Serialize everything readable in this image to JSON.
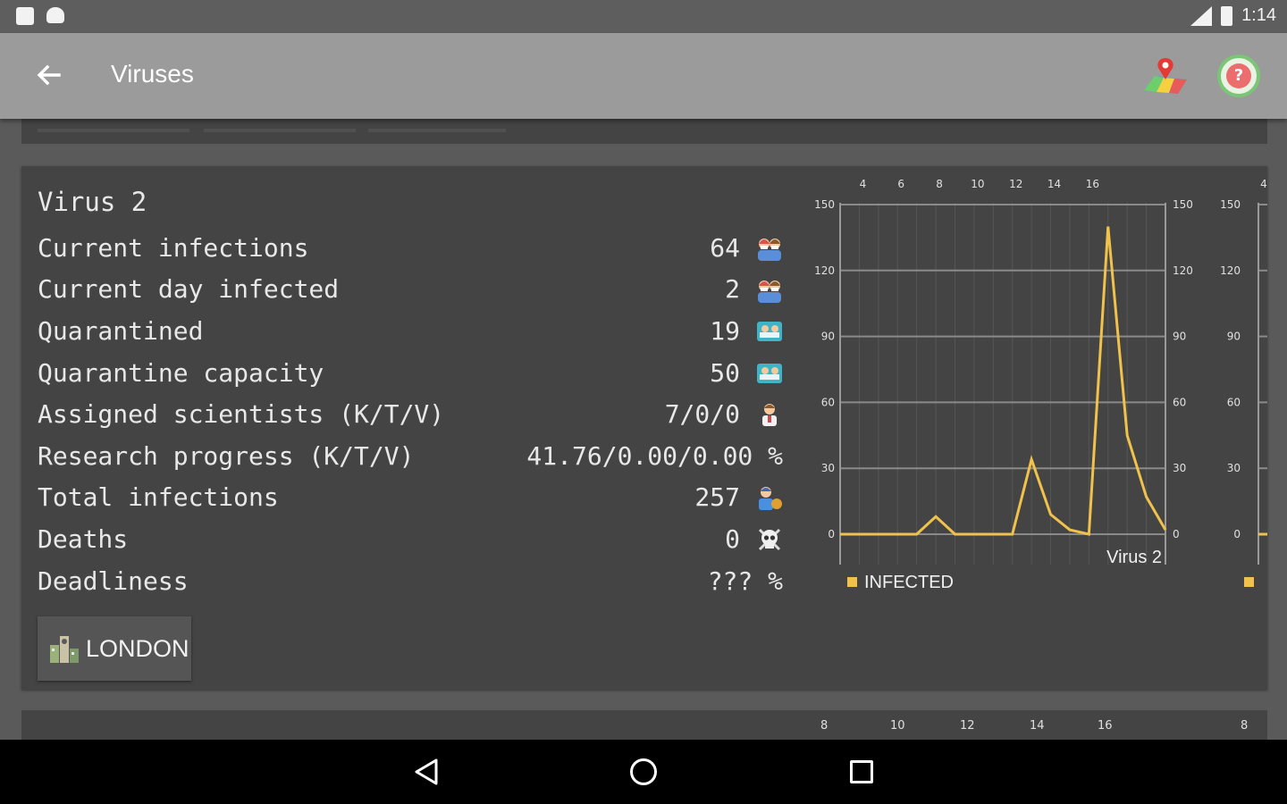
{
  "status_bar": {
    "time": "1:14"
  },
  "app_bar": {
    "title": "Viruses"
  },
  "virus": {
    "name": "Virus 2",
    "rows": [
      {
        "label": "Current infections",
        "value": "64",
        "icon": "infected-people-icon"
      },
      {
        "label": "Current day infected",
        "value": "2",
        "icon": "infected-people-icon"
      },
      {
        "label": "Quarantined",
        "value": "19",
        "icon": "quarantine-icon"
      },
      {
        "label": "Quarantine capacity",
        "value": "50",
        "icon": "quarantine-icon"
      },
      {
        "label": "Assigned scientists (K/T/V)",
        "value": "7/0/0",
        "icon": "scientist-icon"
      },
      {
        "label": "Research progress (K/T/V)",
        "value": "41.76/0.00/0.00 %",
        "icon": ""
      },
      {
        "label": "Total infections",
        "value": "257",
        "icon": "total-infections-icon"
      },
      {
        "label": "Deaths",
        "value": "0",
        "icon": "skull-icon"
      },
      {
        "label": "Deadliness",
        "value": "??? %",
        "icon": ""
      }
    ],
    "city_button": "LONDON"
  },
  "colors": {
    "line": "#f0c24b",
    "card": "#444444",
    "appbar": "#9b9b9b"
  },
  "chart_data": {
    "type": "line",
    "x": [
      1,
      2,
      3,
      4,
      5,
      6,
      7,
      8,
      9,
      10,
      11,
      12,
      13,
      14,
      15,
      16,
      17
    ],
    "x_ticks": [
      "4",
      "6",
      "8",
      "10",
      "12",
      "14",
      "16"
    ],
    "y_ticks": [
      "0",
      "30",
      "60",
      "90",
      "120",
      "150"
    ],
    "xlim": [
      1,
      17
    ],
    "ylim": [
      0,
      150
    ],
    "series": [
      {
        "name": "INFECTED",
        "values": [
          0,
          0,
          0,
          0,
          0,
          8,
          0,
          0,
          0,
          0,
          34,
          9,
          2,
          0,
          140,
          45,
          17,
          2
        ]
      }
    ],
    "label": "Virus 2",
    "grid": true,
    "legend": "bottom-left"
  },
  "side_chart": {
    "y_ticks": [
      "0",
      "30",
      "60",
      "90",
      "120",
      "150"
    ],
    "x_tick": "4"
  },
  "bottom_card": {
    "x_ticks": [
      "8",
      "10",
      "12",
      "14",
      "16",
      "8"
    ]
  }
}
